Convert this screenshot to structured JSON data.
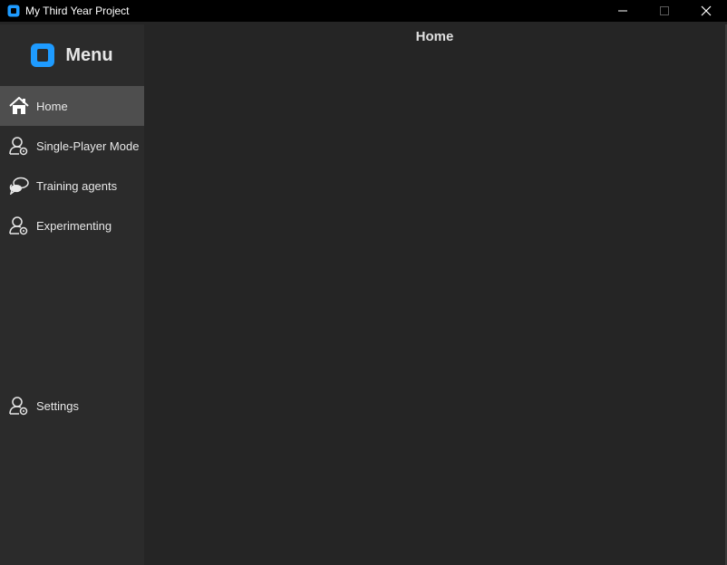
{
  "window": {
    "title": "My Third Year Project",
    "controls": {
      "minimize": "minimize",
      "maximize": "maximize",
      "close": "close"
    }
  },
  "sidebar": {
    "menu_title": "Menu",
    "items": [
      {
        "label": "Home",
        "icon": "home-icon",
        "active": true
      },
      {
        "label": "Single-Player Mode",
        "icon": "user-settings-icon",
        "active": false
      },
      {
        "label": "Training agents",
        "icon": "chat-bubbles-icon",
        "active": false
      },
      {
        "label": "Experimenting",
        "icon": "user-settings-icon",
        "active": false
      }
    ],
    "settings": {
      "label": "Settings",
      "icon": "user-settings-icon"
    }
  },
  "main": {
    "page_title": "Home"
  },
  "colors": {
    "accent": "#1e9bff",
    "titlebar": "#000000",
    "sidebar_bg": "#2b2b2b",
    "active_item_bg": "#4e4e4e",
    "main_bg": "#252525"
  }
}
